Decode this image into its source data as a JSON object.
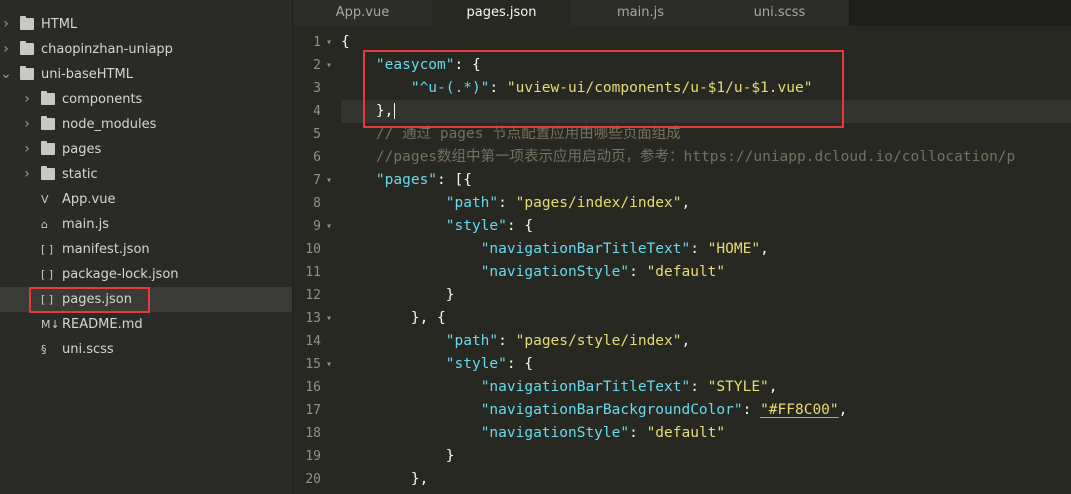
{
  "sidebar": {
    "items": [
      {
        "label": "HTML",
        "type": "folder",
        "expanded": false,
        "level": 0
      },
      {
        "label": "chaopinzhan-uniapp",
        "type": "folder",
        "expanded": false,
        "level": 0
      },
      {
        "label": "uni-baseHTML",
        "type": "folder",
        "expanded": true,
        "level": 0
      },
      {
        "label": "components",
        "type": "folder",
        "expanded": false,
        "level": 1
      },
      {
        "label": "node_modules",
        "type": "folder",
        "expanded": false,
        "level": 1
      },
      {
        "label": "pages",
        "type": "folder",
        "expanded": false,
        "level": 1
      },
      {
        "label": "static",
        "type": "folder",
        "expanded": false,
        "level": 1
      },
      {
        "label": "App.vue",
        "type": "vue",
        "level": 1
      },
      {
        "label": "main.js",
        "type": "js",
        "level": 1
      },
      {
        "label": "manifest.json",
        "type": "json",
        "level": 1
      },
      {
        "label": "package-lock.json",
        "type": "json",
        "level": 1
      },
      {
        "label": "pages.json",
        "type": "json",
        "level": 1,
        "selected": true
      },
      {
        "label": "README.md",
        "type": "md",
        "level": 1
      },
      {
        "label": "uni.scss",
        "type": "scss",
        "level": 1
      }
    ]
  },
  "tabs": [
    {
      "label": "App.vue"
    },
    {
      "label": "pages.json",
      "active": true
    },
    {
      "label": "main.js"
    },
    {
      "label": "uni.scss"
    }
  ],
  "editor": {
    "line_numbers": [
      "1",
      "2",
      "3",
      "4",
      "5",
      "6",
      "7",
      "8",
      "9",
      "10",
      "11",
      "12",
      "13",
      "14",
      "15",
      "16",
      "17",
      "18",
      "19",
      "20"
    ],
    "lines": [
      {
        "indent": "",
        "tokens": [
          {
            "t": "{",
            "c": "p"
          }
        ]
      },
      {
        "indent": "    ",
        "tokens": [
          {
            "t": "\"easycom\"",
            "c": "k"
          },
          {
            "t": ": {",
            "c": "p"
          }
        ]
      },
      {
        "indent": "        ",
        "tokens": [
          {
            "t": "\"^u-(.*)\"",
            "c": "k"
          },
          {
            "t": ": ",
            "c": "p"
          },
          {
            "t": "\"uview-ui/components/u-$1/u-$1.vue\"",
            "c": "s"
          }
        ]
      },
      {
        "indent": "    ",
        "tokens": [
          {
            "t": "},",
            "c": "p"
          }
        ]
      },
      {
        "indent": "    ",
        "tokens": [
          {
            "t": "// 通过 pages 节点配置应用由哪些页面组成",
            "c": "c"
          }
        ]
      },
      {
        "indent": "    ",
        "tokens": [
          {
            "t": "//pages数组中第一项表示应用启动页，参考：https://uniapp.dcloud.io/collocation/p",
            "c": "c"
          }
        ]
      },
      {
        "indent": "    ",
        "tokens": [
          {
            "t": "\"pages\"",
            "c": "k"
          },
          {
            "t": ": [{",
            "c": "p"
          }
        ]
      },
      {
        "indent": "            ",
        "tokens": [
          {
            "t": "\"path\"",
            "c": "k"
          },
          {
            "t": ": ",
            "c": "p"
          },
          {
            "t": "\"pages/index/index\"",
            "c": "s"
          },
          {
            "t": ",",
            "c": "p"
          }
        ]
      },
      {
        "indent": "            ",
        "tokens": [
          {
            "t": "\"style\"",
            "c": "k"
          },
          {
            "t": ": {",
            "c": "p"
          }
        ]
      },
      {
        "indent": "                ",
        "tokens": [
          {
            "t": "\"navigationBarTitleText\"",
            "c": "k"
          },
          {
            "t": ": ",
            "c": "p"
          },
          {
            "t": "\"HOME\"",
            "c": "s"
          },
          {
            "t": ",",
            "c": "p"
          }
        ]
      },
      {
        "indent": "                ",
        "tokens": [
          {
            "t": "\"navigationStyle\"",
            "c": "k"
          },
          {
            "t": ": ",
            "c": "p"
          },
          {
            "t": "\"default\"",
            "c": "s"
          }
        ]
      },
      {
        "indent": "            ",
        "tokens": [
          {
            "t": "}",
            "c": "p"
          }
        ]
      },
      {
        "indent": "        ",
        "tokens": [
          {
            "t": "}, {",
            "c": "p"
          }
        ]
      },
      {
        "indent": "            ",
        "tokens": [
          {
            "t": "\"path\"",
            "c": "k"
          },
          {
            "t": ": ",
            "c": "p"
          },
          {
            "t": "\"pages/style/index\"",
            "c": "s"
          },
          {
            "t": ",",
            "c": "p"
          }
        ]
      },
      {
        "indent": "            ",
        "tokens": [
          {
            "t": "\"style\"",
            "c": "k"
          },
          {
            "t": ": {",
            "c": "p"
          }
        ]
      },
      {
        "indent": "                ",
        "tokens": [
          {
            "t": "\"navigationBarTitleText\"",
            "c": "k"
          },
          {
            "t": ": ",
            "c": "p"
          },
          {
            "t": "\"STYLE\"",
            "c": "s"
          },
          {
            "t": ",",
            "c": "p"
          }
        ]
      },
      {
        "indent": "                ",
        "tokens": [
          {
            "t": "\"navigationBarBackgroundColor\"",
            "c": "k"
          },
          {
            "t": ": ",
            "c": "p"
          },
          {
            "t": "\"#FF8C00\"",
            "c": "s u"
          },
          {
            "t": ",",
            "c": "p"
          }
        ]
      },
      {
        "indent": "                ",
        "tokens": [
          {
            "t": "\"navigationStyle\"",
            "c": "k"
          },
          {
            "t": ": ",
            "c": "p"
          },
          {
            "t": "\"default\"",
            "c": "s"
          }
        ]
      },
      {
        "indent": "            ",
        "tokens": [
          {
            "t": "}",
            "c": "p"
          }
        ]
      },
      {
        "indent": "        ",
        "tokens": [
          {
            "t": "},",
            "c": "p"
          }
        ]
      }
    ],
    "current_line": 4
  },
  "colors": {
    "background": "#272822",
    "sidebar_bg": "#2a2b27",
    "highlight_box": "#e53b3b",
    "keyword": "#66d9ef",
    "string": "#e6db74",
    "comment": "#75715e"
  }
}
